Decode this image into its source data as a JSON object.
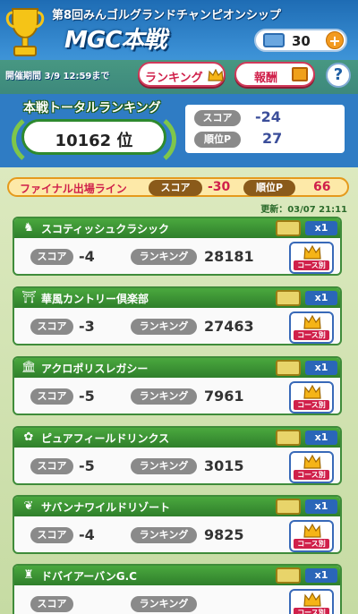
{
  "header": {
    "subtitle": "第8回みんゴルグランドチャンピオンシップ",
    "title": "MGC本戦",
    "ticket_count": "30",
    "plus": "+",
    "period": "開催期間 3/9 12:59まで",
    "ranking_label": "ランキング",
    "reward_label": "報酬",
    "help": "?"
  },
  "total": {
    "label": "本戦トータルランキング",
    "rank": "10162 位",
    "score_label": "スコア",
    "score": "-24",
    "points_label": "順位P",
    "points": "27"
  },
  "final_line": {
    "label": "ファイナル出場ライン",
    "score_label": "スコア",
    "score": "-30",
    "points_label": "順位P",
    "points": "66"
  },
  "updated": "更新：03/07 21:11",
  "labels": {
    "score": "スコア",
    "ranking": "ランキング",
    "multiplier": "x1",
    "course_button": "コース別"
  },
  "courses": [
    {
      "name": "スコティッシュクラシック",
      "icon": "horse-icon",
      "glyph": "♞",
      "score": "-4",
      "ranking": "28181"
    },
    {
      "name": "華風カントリー倶楽部",
      "icon": "pagoda-icon",
      "glyph": "⛩",
      "score": "-3",
      "ranking": "27463"
    },
    {
      "name": "アクロポリスレガシー",
      "icon": "temple-icon",
      "glyph": "🏛",
      "score": "-5",
      "ranking": "7961"
    },
    {
      "name": "ピュアフィールドリンクス",
      "icon": "flower-icon",
      "glyph": "✿",
      "score": "-5",
      "ranking": "3015"
    },
    {
      "name": "サバンナワイルドリゾート",
      "icon": "leaf-icon",
      "glyph": "❦",
      "score": "-4",
      "ranking": "9825"
    },
    {
      "name": "ドバイアーバンG.C",
      "icon": "tower-icon",
      "glyph": "♜",
      "score": "",
      "ranking": ""
    }
  ]
}
